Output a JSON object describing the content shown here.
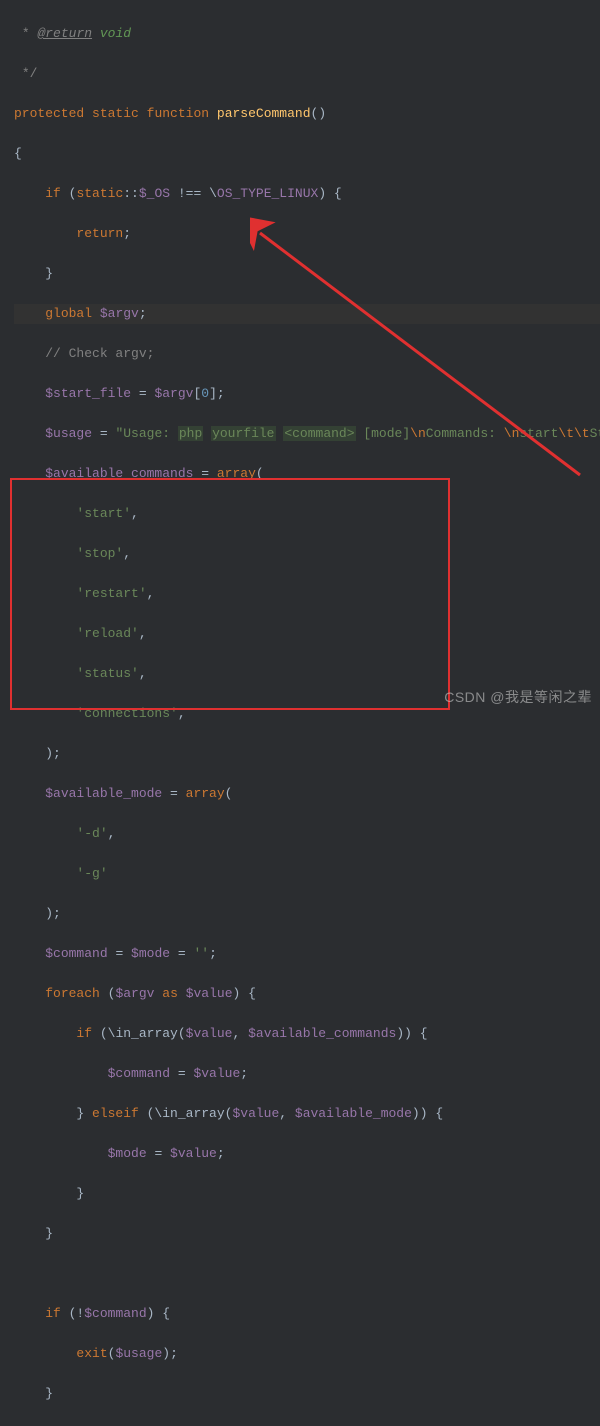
{
  "doc": {
    "tag": "@return",
    "type": "void"
  },
  "fn": {
    "mod1": "protected",
    "mod2": "static",
    "mod3": "function",
    "name": "parseCommand"
  },
  "l_if": "if",
  "l_return": "return",
  "l_global": "global",
  "l_as": "as",
  "l_foreach": "foreach",
  "l_elseif": "elseif",
  "l_array": "array",
  "comment_check": "// Check argv;",
  "v_static": "static",
  "v_os": "$_OS",
  "v_oslinux": "OS_TYPE_LINUX",
  "v_argv": "$argv",
  "v_start_file": "$start_file",
  "v_usage": "$usage",
  "v_available_commands": "$available_commands",
  "v_available_mode": "$available_mode",
  "v_command": "$command",
  "v_mode": "$mode",
  "v_value": "$value",
  "num_zero": "0",
  "usage_p1": "\"Usage: ",
  "usage_p2": "php",
  "usage_p3": "yourfile",
  "usage_p4": "<command>",
  "usage_p5": " [mode]",
  "usage_p6": "\\n",
  "usage_p7": "Commands: ",
  "usage_p8": "\\n",
  "usage_p9": "start",
  "usage_p10": "\\t\\t",
  "usage_p11": "Start work",
  "arr_start": "'start'",
  "arr_stop": "'stop'",
  "arr_restart": "'restart'",
  "arr_reload": "'reload'",
  "arr_status": "'status'",
  "arr_connections": "'connections'",
  "mode_d": "'-d'",
  "mode_g": "'-g'",
  "s_empty": "''",
  "fn_in_array": "in_array",
  "fn_exit": "exit",
  "watermark": "CSDN @我是等闲之辈"
}
